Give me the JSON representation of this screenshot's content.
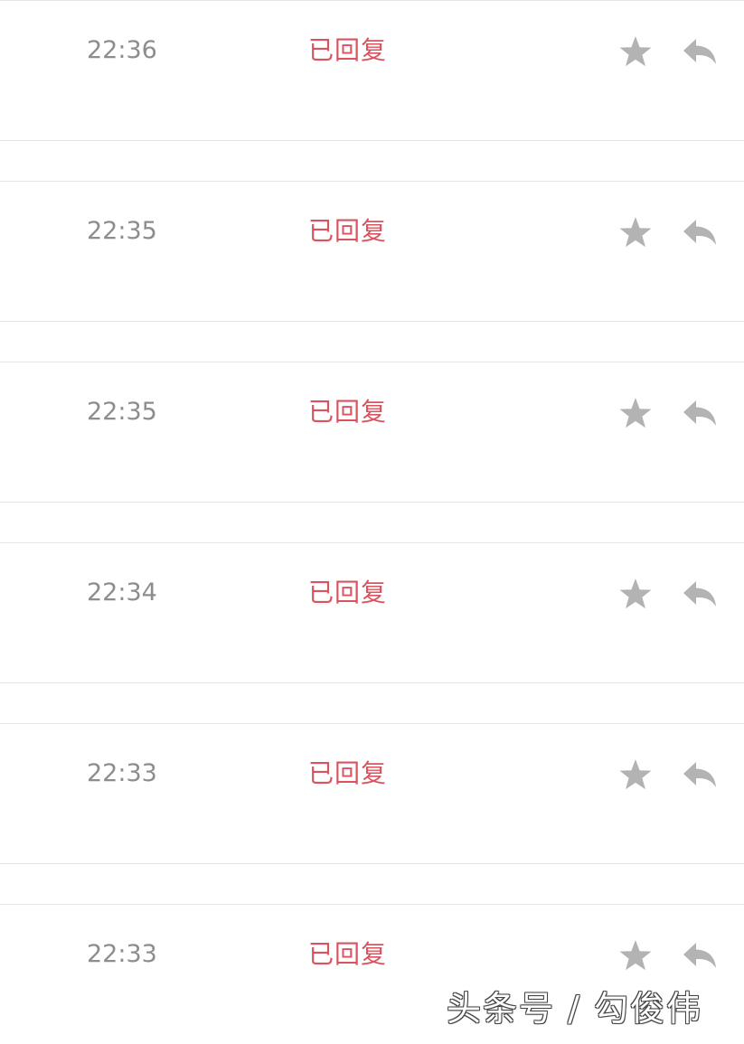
{
  "messages": [
    {
      "time": "22:36",
      "status": "已回复"
    },
    {
      "time": "22:35",
      "status": "已回复"
    },
    {
      "time": "22:35",
      "status": "已回复"
    },
    {
      "time": "22:34",
      "status": "已回复"
    },
    {
      "time": "22:33",
      "status": "已回复"
    },
    {
      "time": "22:33",
      "status": "已回复"
    }
  ],
  "icons": {
    "star": "star-icon",
    "reply": "reply-icon"
  },
  "colors": {
    "status": "#d9545f",
    "time": "#8d8d8d",
    "icon": "#b3b3b3",
    "divider": "#e5e5e5"
  },
  "watermark": "头条号 / 勾俊伟"
}
